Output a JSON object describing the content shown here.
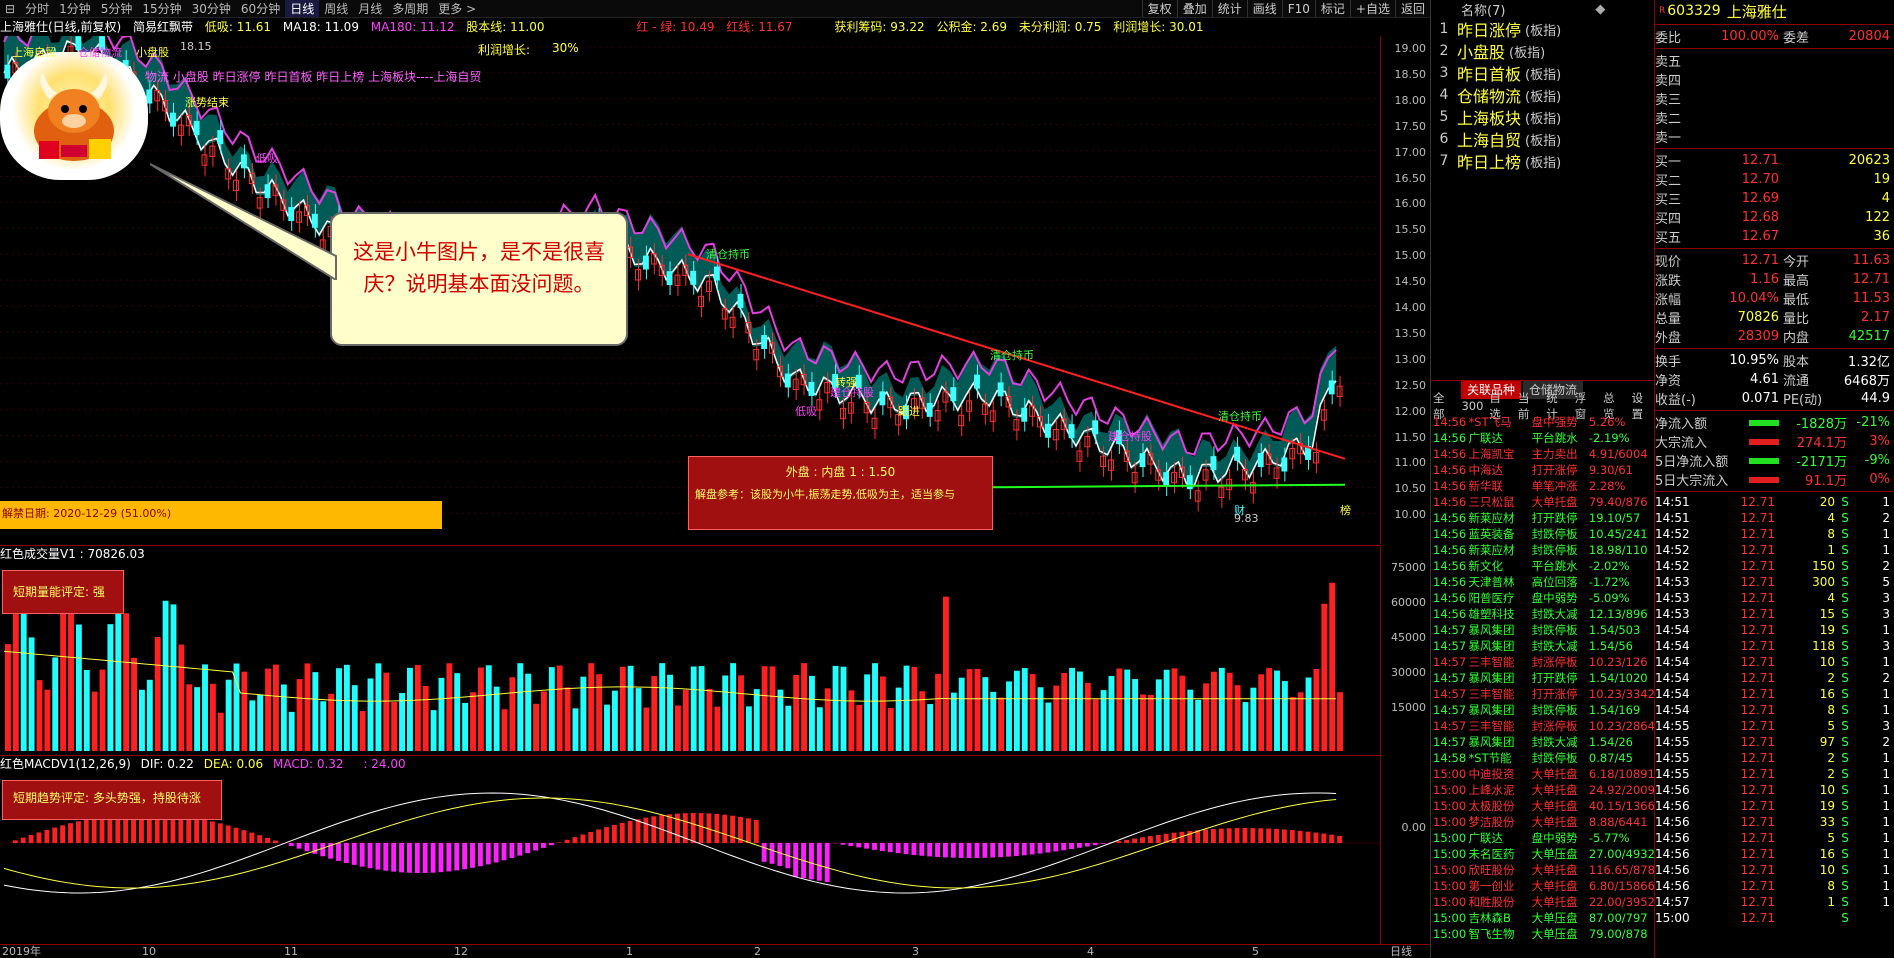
{
  "toolbar": {
    "periods": [
      "分时",
      "1分钟",
      "5分钟",
      "15分钟",
      "30分钟",
      "60分钟",
      "日线",
      "周线",
      "月线",
      "多周期",
      "更多 >"
    ],
    "active_period": "日线",
    "right_buttons": [
      "复权",
      "叠加",
      "统计",
      "画线",
      "F10",
      "标记",
      "+自选",
      "返回"
    ]
  },
  "infobar": {
    "title": "上海雅仕(日线,前复权)",
    "indicator": "简易红飘带",
    "low_absorb": "低吸: 11.61",
    "ma18": "MA18: 11.09",
    "ma180": "MA180: 11.12",
    "base": "股本线: 11.00",
    "redgreen": "红 - 绿: 10.49",
    "redline": "红线: 11.67",
    "profit_chip": "获利筹码: 93.22",
    "reserve": "公积金: 2.69",
    "undistributed": "未分利润: 0.75",
    "profit_growth": "利润增长: 30.01",
    "profit_growth2": "利润增长:",
    "profit_growth2_val": "30%"
  },
  "main_chart": {
    "concept_text": "  物流  小盘股 昨日涨停 昨日首板 昨日上榜 上海板块----上海自贸",
    "price_ticks": [
      "19.00",
      "18.50",
      "18.00",
      "17.50",
      "17.00",
      "16.50",
      "16.00",
      "15.50",
      "15.00",
      "14.50",
      "14.00",
      "13.50",
      "13.00",
      "12.50",
      "12.00",
      "11.50",
      "11.00",
      "10.50",
      "10.00"
    ],
    "unlock_date": "解禁日期: 2020-12-29 (51.00%)",
    "callout_text": "这是小牛图片，是不是很喜庆？说明基本面没问题。",
    "outer_inner": "外盘 : 内盘  1 : 1.50",
    "advice": "解盘参考：该股为小牛,振荡走势,低吸为主，适当参与",
    "low_value": "9.83",
    "labels": {
      "qingcang": "清仓持币",
      "jiancang": "建仓持股",
      "dixi": "低吸",
      "zhuanqiang": "转强",
      "genjin": "跟进",
      "diejie": "跌",
      "jian": "减",
      "cai": "财",
      "bang": "榜",
      "zhangshi": "涨势结束",
      "peak": "18.15",
      "shanghai": "上海自贸",
      "xiaopan": "小盘股",
      "cangchu": "仓储物流"
    }
  },
  "volume": {
    "title": "红色成交量V1 : 70826.03",
    "ticks": [
      "75000",
      "60000",
      "45000",
      "30000",
      "15000"
    ],
    "box": "短期量能评定: 强"
  },
  "macd": {
    "title": "红色MACDV1(12,26,9)",
    "dif": "DIF: 0.22",
    "dea": "DEA: 0.06",
    "macd": "MACD: 0.32",
    "extra": ": 24.00",
    "zero": "0.00",
    "box": "短期趋势评定: 多头势强，持股待涨"
  },
  "date_axis": {
    "labels": [
      "2019年",
      "10",
      "11",
      "12",
      "1",
      "2",
      "3",
      "4",
      "5"
    ],
    "corner": "日线"
  },
  "watchlist": {
    "header": "名称(7)",
    "items": [
      {
        "n": "1",
        "name": "昨日涨停",
        "tag": "(板指)"
      },
      {
        "n": "2",
        "name": "小盘股",
        "tag": "(板指)"
      },
      {
        "n": "3",
        "name": "昨日首板",
        "tag": "(板指)"
      },
      {
        "n": "4",
        "name": "仓储物流",
        "tag": "(板指)"
      },
      {
        "n": "5",
        "name": "上海板块",
        "tag": "(板指)"
      },
      {
        "n": "6",
        "name": "上海自贸",
        "tag": "(板指)"
      },
      {
        "n": "7",
        "name": "昨日上榜",
        "tag": "(板指)"
      }
    ]
  },
  "ticks": {
    "tabs": [
      "关联品种",
      "仓储物流"
    ],
    "subtabs": [
      "全部",
      "300",
      "自选",
      "当前",
      "统计",
      "浮窗",
      "总览",
      "设置"
    ],
    "rows": [
      [
        "14:56",
        "*ST飞马",
        "盘中强势",
        "5.26%"
      ],
      [
        "14:56",
        "广联达",
        "平台跳水",
        "-2.19%"
      ],
      [
        "14:56",
        "上海凯宝",
        "主力卖出",
        "4.91/6004"
      ],
      [
        "14:56",
        "中海达",
        "打开涨停",
        "9.30/61"
      ],
      [
        "14:56",
        "新华联",
        "单笔冲涨",
        "2.28%"
      ],
      [
        "14:56",
        "三只松鼠",
        "大单托盘",
        "79.40/876"
      ],
      [
        "14:56",
        "新莱应材",
        "打开跌停",
        "19.10/57"
      ],
      [
        "14:56",
        "蓝英装备",
        "封跌停板",
        "10.45/241"
      ],
      [
        "14:56",
        "新莱应材",
        "封跌停板",
        "18.98/110"
      ],
      [
        "14:56",
        "新文化",
        "平台跳水",
        "-2.02%"
      ],
      [
        "14:56",
        "天津普林",
        "高位回落",
        "-1.72%"
      ],
      [
        "14:56",
        "阳普医疗",
        "盘中弱势",
        "-5.09%"
      ],
      [
        "14:56",
        "雄塑科技",
        "封跌大减",
        "12.13/896"
      ],
      [
        "14:57",
        "暴风集团",
        "封跌停板",
        "1.54/503"
      ],
      [
        "14:57",
        "暴风集团",
        "封跌大减",
        "1.54/56"
      ],
      [
        "14:57",
        "三丰智能",
        "封涨停板",
        "10.23/126"
      ],
      [
        "14:57",
        "暴风集团",
        "打开跌停",
        "1.54/1020"
      ],
      [
        "14:57",
        "三丰智能",
        "打开涨停",
        "10.23/3342"
      ],
      [
        "14:57",
        "暴风集团",
        "封跌停板",
        "1.54/169"
      ],
      [
        "14:57",
        "三丰智能",
        "封涨停板",
        "10.23/2864"
      ],
      [
        "14:57",
        "暴风集团",
        "封跌大减",
        "1.54/26"
      ],
      [
        "14:58",
        "*ST节能",
        "封跌停板",
        "0.87/45"
      ],
      [
        "15:00",
        "中迪投资",
        "大单托盘",
        "6.18/10891"
      ],
      [
        "15:00",
        "上峰水泥",
        "大单托盘",
        "24.92/2009"
      ],
      [
        "15:00",
        "太极股份",
        "大单托盘",
        "40.15/1366"
      ],
      [
        "15:00",
        "梦洁股份",
        "大单托盘",
        "8.88/6441"
      ],
      [
        "15:00",
        "广联达",
        "盘中弱势",
        "-5.77%"
      ],
      [
        "15:00",
        "未名医药",
        "大单压盘",
        "27.00/4932"
      ],
      [
        "15:00",
        "欣旺股份",
        "大单托盘",
        "116.65/878"
      ],
      [
        "15:00",
        "第一创业",
        "大单托盘",
        "6.80/15866"
      ],
      [
        "15:00",
        "和胜股份",
        "大单托盘",
        "22.00/3952"
      ],
      [
        "15:00",
        "吉林森B",
        "大单压盘",
        "87.00/797"
      ],
      [
        "15:00",
        "智飞生物",
        "大单压盘",
        "79.00/878"
      ]
    ]
  },
  "quote": {
    "code": "603329",
    "name": "上海雅仕",
    "weibi_l": "委比",
    "weibi_v": "100.00%",
    "weicha_l": "委差",
    "weicha_v": "20804",
    "sells": [
      {
        "l": "卖五",
        "p": "",
        "v": ""
      },
      {
        "l": "卖四",
        "p": "",
        "v": ""
      },
      {
        "l": "卖三",
        "p": "",
        "v": ""
      },
      {
        "l": "卖二",
        "p": "",
        "v": ""
      },
      {
        "l": "卖一",
        "p": "",
        "v": ""
      }
    ],
    "buys": [
      {
        "l": "买一",
        "p": "12.71",
        "v": "20623"
      },
      {
        "l": "买二",
        "p": "12.70",
        "v": "19"
      },
      {
        "l": "买三",
        "p": "12.69",
        "v": "4"
      },
      {
        "l": "买四",
        "p": "12.68",
        "v": "122"
      },
      {
        "l": "买五",
        "p": "12.67",
        "v": "36"
      }
    ],
    "stats": [
      {
        "l": "现价",
        "v": "12.71",
        "c": "red",
        "l2": "今开",
        "v2": "11.63",
        "c2": "red"
      },
      {
        "l": "涨跌",
        "v": "1.16",
        "c": "red",
        "l2": "最高",
        "v2": "12.71",
        "c2": "red"
      },
      {
        "l": "涨幅",
        "v": "10.04%",
        "c": "red",
        "l2": "最低",
        "v2": "11.53",
        "c2": "red"
      },
      {
        "l": "总量",
        "v": "70826",
        "c": "yel",
        "l2": "量比",
        "v2": "2.17",
        "c2": "red"
      },
      {
        "l": "外盘",
        "v": "28309",
        "c": "red",
        "l2": "内盘",
        "v2": "42517",
        "c2": "grn"
      }
    ],
    "stats2": [
      {
        "l": "换手",
        "v": "10.95%",
        "c": "wht",
        "l2": "股本",
        "v2": "1.32亿",
        "c2": "wht"
      },
      {
        "l": "净资",
        "v": "4.61",
        "c": "wht",
        "l2": "流通",
        "v2": "6468万",
        "c2": "wht"
      },
      {
        "l": "收益(-)",
        "v": "0.071",
        "c": "wht",
        "l2": "PE(动)",
        "v2": "44.9",
        "c2": "wht"
      }
    ],
    "flows": [
      {
        "l": "净流入额",
        "v": "-1828万",
        "p": "-21%",
        "c": "grn"
      },
      {
        "l": "大宗流入",
        "v": "274.1万",
        "p": "3%",
        "c": "red"
      },
      {
        "l": "5日净流入额",
        "v": "-2171万",
        "p": "-9%",
        "c": "grn"
      },
      {
        "l": "5日大宗流入",
        "v": "91.1万",
        "p": "0%",
        "c": "red"
      }
    ],
    "trades": [
      [
        "14:51",
        "12.71",
        "20",
        "S"
      ],
      [
        "14:51",
        "12.71",
        "4",
        "S"
      ],
      [
        "14:52",
        "12.71",
        "8",
        "S"
      ],
      [
        "14:52",
        "12.71",
        "1",
        "S"
      ],
      [
        "14:52",
        "12.71",
        "150",
        "S"
      ],
      [
        "14:53",
        "12.71",
        "300",
        "S"
      ],
      [
        "14:53",
        "12.71",
        "4",
        "S"
      ],
      [
        "14:53",
        "12.71",
        "15",
        "S"
      ],
      [
        "14:54",
        "12.71",
        "19",
        "S"
      ],
      [
        "14:54",
        "12.71",
        "118",
        "S"
      ],
      [
        "14:54",
        "12.71",
        "10",
        "S"
      ],
      [
        "14:54",
        "12.71",
        "2",
        "S"
      ],
      [
        "14:54",
        "12.71",
        "16",
        "S"
      ],
      [
        "14:54",
        "12.71",
        "8",
        "S"
      ],
      [
        "14:55",
        "12.71",
        "5",
        "S"
      ],
      [
        "14:55",
        "12.71",
        "97",
        "S"
      ],
      [
        "14:55",
        "12.71",
        "2",
        "S"
      ],
      [
        "14:55",
        "12.71",
        "2",
        "S"
      ],
      [
        "14:56",
        "12.71",
        "10",
        "S"
      ],
      [
        "14:56",
        "12.71",
        "19",
        "S"
      ],
      [
        "14:56",
        "12.71",
        "33",
        "S"
      ],
      [
        "14:56",
        "12.71",
        "5",
        "S"
      ],
      [
        "14:56",
        "12.71",
        "16",
        "S"
      ],
      [
        "14:56",
        "12.71",
        "10",
        "S"
      ],
      [
        "14:56",
        "12.71",
        "8",
        "S"
      ],
      [
        "14:57",
        "12.71",
        "1",
        "S"
      ],
      [
        "15:00",
        "12.71",
        "",
        "S"
      ]
    ],
    "trade_qty_extra": [
      "1",
      "2",
      "1",
      "1",
      "2",
      "5",
      "3",
      "3",
      "1",
      "3",
      "1",
      "2",
      "1",
      "1",
      "3",
      "2",
      "1",
      "1",
      "1",
      "1",
      "1",
      "1",
      "1",
      "1",
      "1",
      "1",
      ""
    ]
  }
}
